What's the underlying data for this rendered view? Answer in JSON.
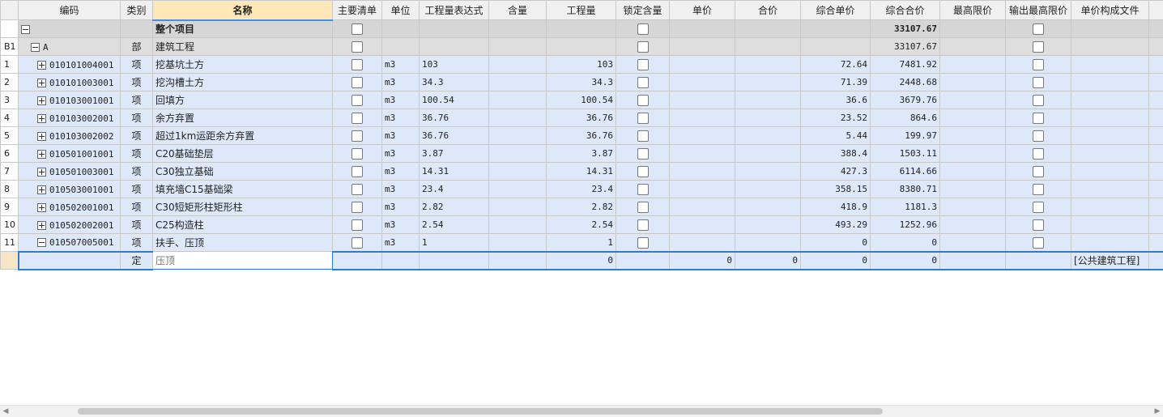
{
  "columns": [
    "编码",
    "类别",
    "名称",
    "主要清单",
    "单位",
    "工程量表达式",
    "含量",
    "工程量",
    "锁定含量",
    "单价",
    "合价",
    "综合单价",
    "综合合价",
    "最高限价",
    "输出最高限价",
    "单价构成文件"
  ],
  "total_row": {
    "code": "",
    "name": "整个项目",
    "combined_total": "33107.67"
  },
  "group_row": {
    "row": "B1",
    "code": "A",
    "type": "部",
    "name": "建筑工程",
    "combined_total": "33107.67"
  },
  "items": [
    {
      "row": "1",
      "code": "010101004001",
      "type": "项",
      "name": "挖基坑土方",
      "unit": "m3",
      "expr": "103",
      "qty": "103",
      "unit_price": "72.64",
      "total": "7481.92"
    },
    {
      "row": "2",
      "code": "010101003001",
      "type": "项",
      "name": "挖沟槽土方",
      "unit": "m3",
      "expr": "34.3",
      "qty": "34.3",
      "unit_price": "71.39",
      "total": "2448.68"
    },
    {
      "row": "3",
      "code": "010103001001",
      "type": "项",
      "name": "回填方",
      "unit": "m3",
      "expr": "100.54",
      "qty": "100.54",
      "unit_price": "36.6",
      "total": "3679.76"
    },
    {
      "row": "4",
      "code": "010103002001",
      "type": "项",
      "name": "余方弃置",
      "unit": "m3",
      "expr": "36.76",
      "qty": "36.76",
      "unit_price": "23.52",
      "total": "864.6"
    },
    {
      "row": "5",
      "code": "010103002002",
      "type": "项",
      "name": "超过1km运距余方弃置",
      "unit": "m3",
      "expr": "36.76",
      "qty": "36.76",
      "unit_price": "5.44",
      "total": "199.97"
    },
    {
      "row": "6",
      "code": "010501001001",
      "type": "项",
      "name": "C20基础垫层",
      "unit": "m3",
      "expr": "3.87",
      "qty": "3.87",
      "unit_price": "388.4",
      "total": "1503.11"
    },
    {
      "row": "7",
      "code": "010501003001",
      "type": "项",
      "name": "C30独立基础",
      "unit": "m3",
      "expr": "14.31",
      "qty": "14.31",
      "unit_price": "427.3",
      "total": "6114.66"
    },
    {
      "row": "8",
      "code": "010503001001",
      "type": "项",
      "name": "填充墙C15基础梁",
      "unit": "m3",
      "expr": "23.4",
      "qty": "23.4",
      "unit_price": "358.15",
      "total": "8380.71"
    },
    {
      "row": "9",
      "code": "010502001001",
      "type": "项",
      "name": "C30短矩形柱矩形柱",
      "unit": "m3",
      "expr": "2.82",
      "qty": "2.82",
      "unit_price": "418.9",
      "total": "1181.3"
    },
    {
      "row": "10",
      "code": "010502002001",
      "type": "项",
      "name": "C25构造柱",
      "unit": "m3",
      "expr": "2.54",
      "qty": "2.54",
      "unit_price": "493.29",
      "total": "1252.96"
    },
    {
      "row": "11",
      "code": "010507005001",
      "type": "项",
      "name": "扶手、压顶",
      "unit": "m3",
      "expr": "1",
      "qty": "1",
      "unit_price": "0",
      "total": "0",
      "expanded": true
    }
  ],
  "sub_row": {
    "type": "定",
    "name_input": "压顶",
    "qty": "0",
    "unit_price": "0",
    "amount": "0",
    "combined_unit_price": "0",
    "combined_total": "0",
    "price_file": "[公共建筑工程]"
  }
}
